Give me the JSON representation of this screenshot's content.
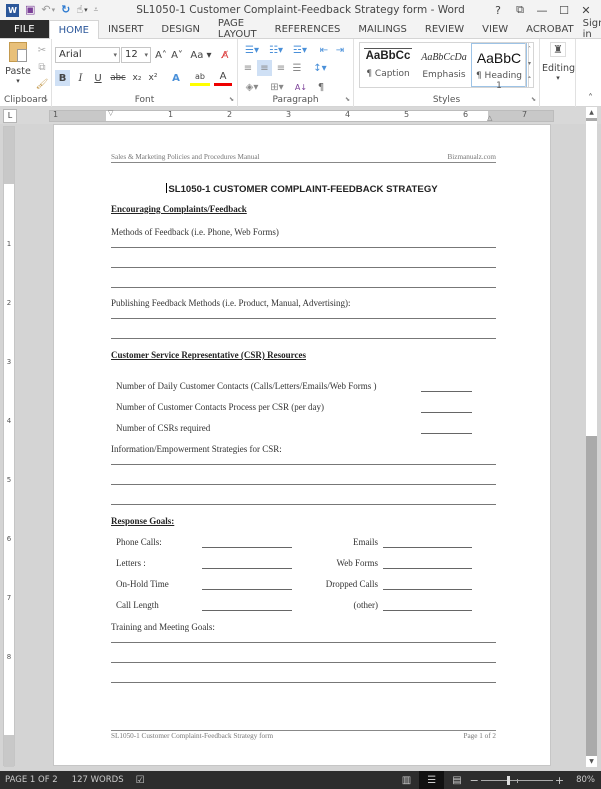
{
  "window": {
    "title": "SL1050-1 Customer Complaint-Feedback Strategy form - Word",
    "controls": {
      "help": "?",
      "ribbon_display": "⧉",
      "minimize": "—",
      "maximize": "☐",
      "close": "✕"
    }
  },
  "qat": {
    "word_logo": "W",
    "save_icon": "💾",
    "undo_icon": "↶",
    "undo_dd": "▾",
    "redo_icon": "↻",
    "touch_icon": "☝",
    "touch_dd": "▾",
    "customize": "⩡"
  },
  "tabs": [
    {
      "label": "FILE"
    },
    {
      "label": "HOME"
    },
    {
      "label": "INSERT"
    },
    {
      "label": "DESIGN"
    },
    {
      "label": "PAGE LAYOUT"
    },
    {
      "label": "REFERENCES"
    },
    {
      "label": "MAILINGS"
    },
    {
      "label": "REVIEW"
    },
    {
      "label": "VIEW"
    },
    {
      "label": "ACROBAT"
    }
  ],
  "sign_in": "Sign in",
  "ribbon": {
    "clipboard": {
      "label": "Clipboard",
      "paste": "Paste",
      "paste_dd": "▾"
    },
    "font": {
      "label": "Font",
      "font_name": "Arial",
      "font_size": "12",
      "grow": "A˄",
      "shrink": "A˅",
      "case": "Aa ▾",
      "clear": "A⌫",
      "bold": "B",
      "italic": "I",
      "underline": "U",
      "strike": "abc",
      "subscript": "x₂",
      "superscript": "x²",
      "effects": "A",
      "highlight": "ab",
      "font_color": "A"
    },
    "paragraph": {
      "label": "Paragraph",
      "sort": "A↓",
      "pilcrow": "¶"
    },
    "styles": {
      "label": "Styles",
      "items": [
        {
          "preview": "AaBbCc",
          "name": "¶ Caption"
        },
        {
          "preview": "AaBbCcDa",
          "name": "Emphasis"
        },
        {
          "preview": "AaBbC",
          "name": "¶ Heading 1"
        }
      ]
    },
    "editing": {
      "label": "Editing",
      "dd": "▾"
    },
    "collapse": "˄"
  },
  "ruler": {
    "tab_selector": "L",
    "h_numbers": [
      "1",
      "1",
      "2",
      "3",
      "4",
      "5",
      "6",
      "7"
    ],
    "v_numbers": [
      "1",
      "2",
      "3",
      "4",
      "5",
      "6",
      "7",
      "8"
    ]
  },
  "document": {
    "header_left": "Sales & Marketing Policies and Procedures Manual",
    "header_right": "Bizmanualz.com",
    "title": "SL1050-1 CUSTOMER COMPLAINT-FEEDBACK STRATEGY",
    "section1": {
      "heading": "Encouraging Complaints/Feedback",
      "methods_label": "Methods of Feedback (i.e. Phone, Web Forms)",
      "publishing_label": "Publishing Feedback Methods (i.e. Product, Manual, Advertising):"
    },
    "section2": {
      "heading": "Customer Service Representative (CSR) Resources",
      "rows": [
        {
          "label": "Number of Daily Customer Contacts (Calls/Letters/Emails/Web Forms )"
        },
        {
          "label": "Number of Customer Contacts Process per CSR (per day)"
        },
        {
          "label": "Number of CSRs required"
        }
      ],
      "strategies_label": "Information/Empowerment Strategies for CSR:"
    },
    "section3": {
      "heading": "Response Goals:",
      "left": [
        "Phone Calls:",
        "Letters :",
        "On-Hold Time",
        "Call Length"
      ],
      "right": [
        "Emails",
        "Web Forms",
        "Dropped Calls",
        "(other)"
      ],
      "training_label": "Training and Meeting Goals:"
    },
    "footer_left": "SL1050-1 Customer Complaint-Feedback Strategy form",
    "footer_right": "Page 1 of 2"
  },
  "statusbar": {
    "page": "PAGE 1 OF 2",
    "words": "127 WORDS",
    "proof_icon": "📖",
    "zoom": "80%",
    "zoom_percent": 80,
    "minus": "−",
    "plus": "+"
  }
}
